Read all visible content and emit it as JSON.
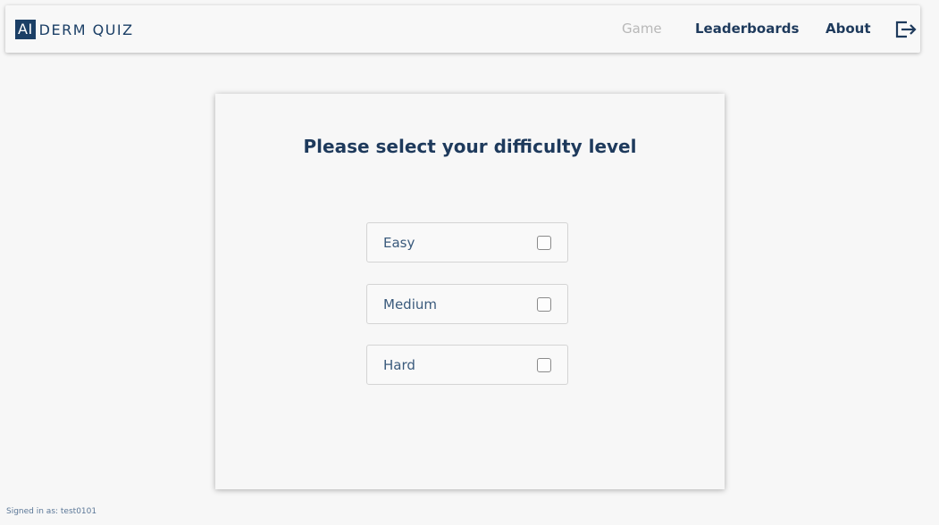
{
  "app": {
    "logo_badge": "AI",
    "logo_text": "DERM QUIZ"
  },
  "nav": {
    "game": "Game",
    "leaderboards": "Leaderboards",
    "about": "About",
    "logout_icon": "logout-icon"
  },
  "main": {
    "title": "Please select your difficulty level",
    "options": [
      {
        "label": "Easy",
        "checked": false
      },
      {
        "label": "Medium",
        "checked": false
      },
      {
        "label": "Hard",
        "checked": false
      }
    ]
  },
  "footer": {
    "signed_in": "Signed in as: test0101"
  },
  "colors": {
    "brand": "#1b3f66",
    "nav_inactive": "#b8b8b8",
    "background": "#f7f7f7"
  }
}
